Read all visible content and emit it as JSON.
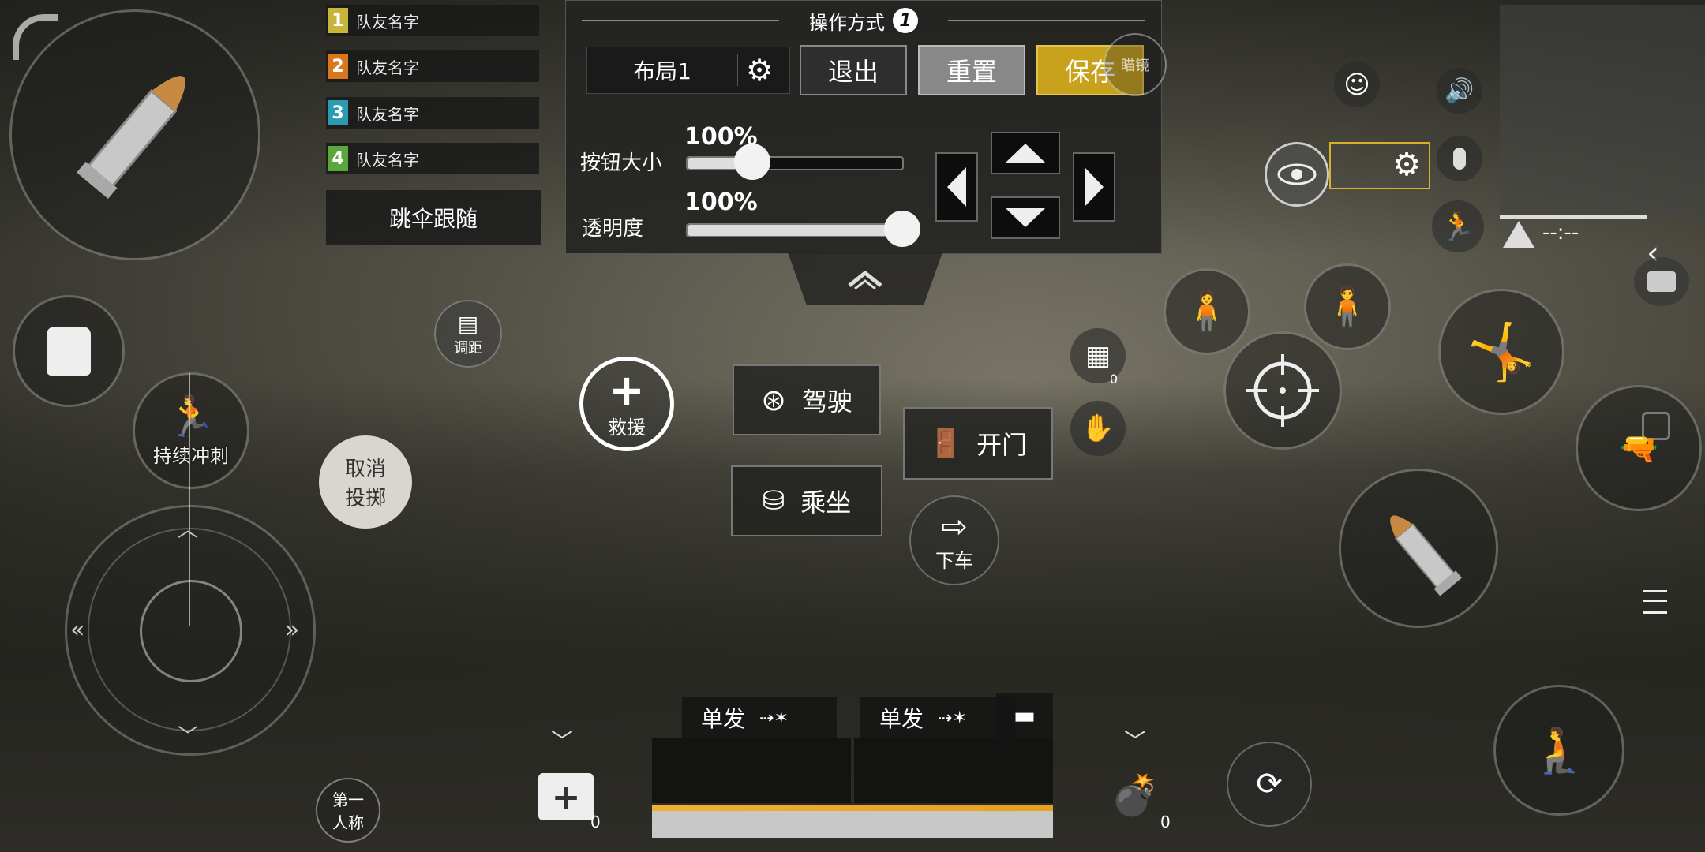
{
  "teammates": [
    {
      "num": "1",
      "name": "队友名字",
      "color": "#c9b43a"
    },
    {
      "num": "2",
      "name": "队友名字",
      "color": "#d9771d"
    },
    {
      "num": "3",
      "name": "队友名字",
      "color": "#2a9bb3"
    },
    {
      "num": "4",
      "name": "队友名字",
      "color": "#5aa83a"
    }
  ],
  "parachute_follow": "跳伞跟随",
  "settings": {
    "title": "操作方式",
    "title_badge": "1",
    "layout_label": "布局1",
    "exit": "退出",
    "reset": "重置",
    "save": "保存",
    "button_size_label": "按钮大小",
    "button_size_value": "100%",
    "opacity_label": "透明度",
    "opacity_value": "100%",
    "button_size_fraction": 0.3,
    "opacity_fraction": 1.0
  },
  "controls": {
    "adjust_distance": "调距",
    "continuous_sprint": "持续冲刺",
    "cancel_throw_line1": "取消",
    "cancel_throw_line2": "投掷",
    "rescue": "救援",
    "drive": "驾驶",
    "ride": "乘坐",
    "open_door": "开门",
    "exit_vehicle": "下车",
    "first_person_line1": "第一",
    "first_person_line2": "人称",
    "crate_count": "0",
    "medkit_count": "0",
    "grenade_count": "0",
    "scope_partial": "瞄镜"
  },
  "weapons": [
    {
      "fire_mode": "单发"
    },
    {
      "fire_mode": "单发"
    }
  ],
  "minimap": {
    "timer": "--:--"
  },
  "colors": {
    "save_bg": "#c9a21d",
    "accent_yellow": "#d7b12a"
  }
}
